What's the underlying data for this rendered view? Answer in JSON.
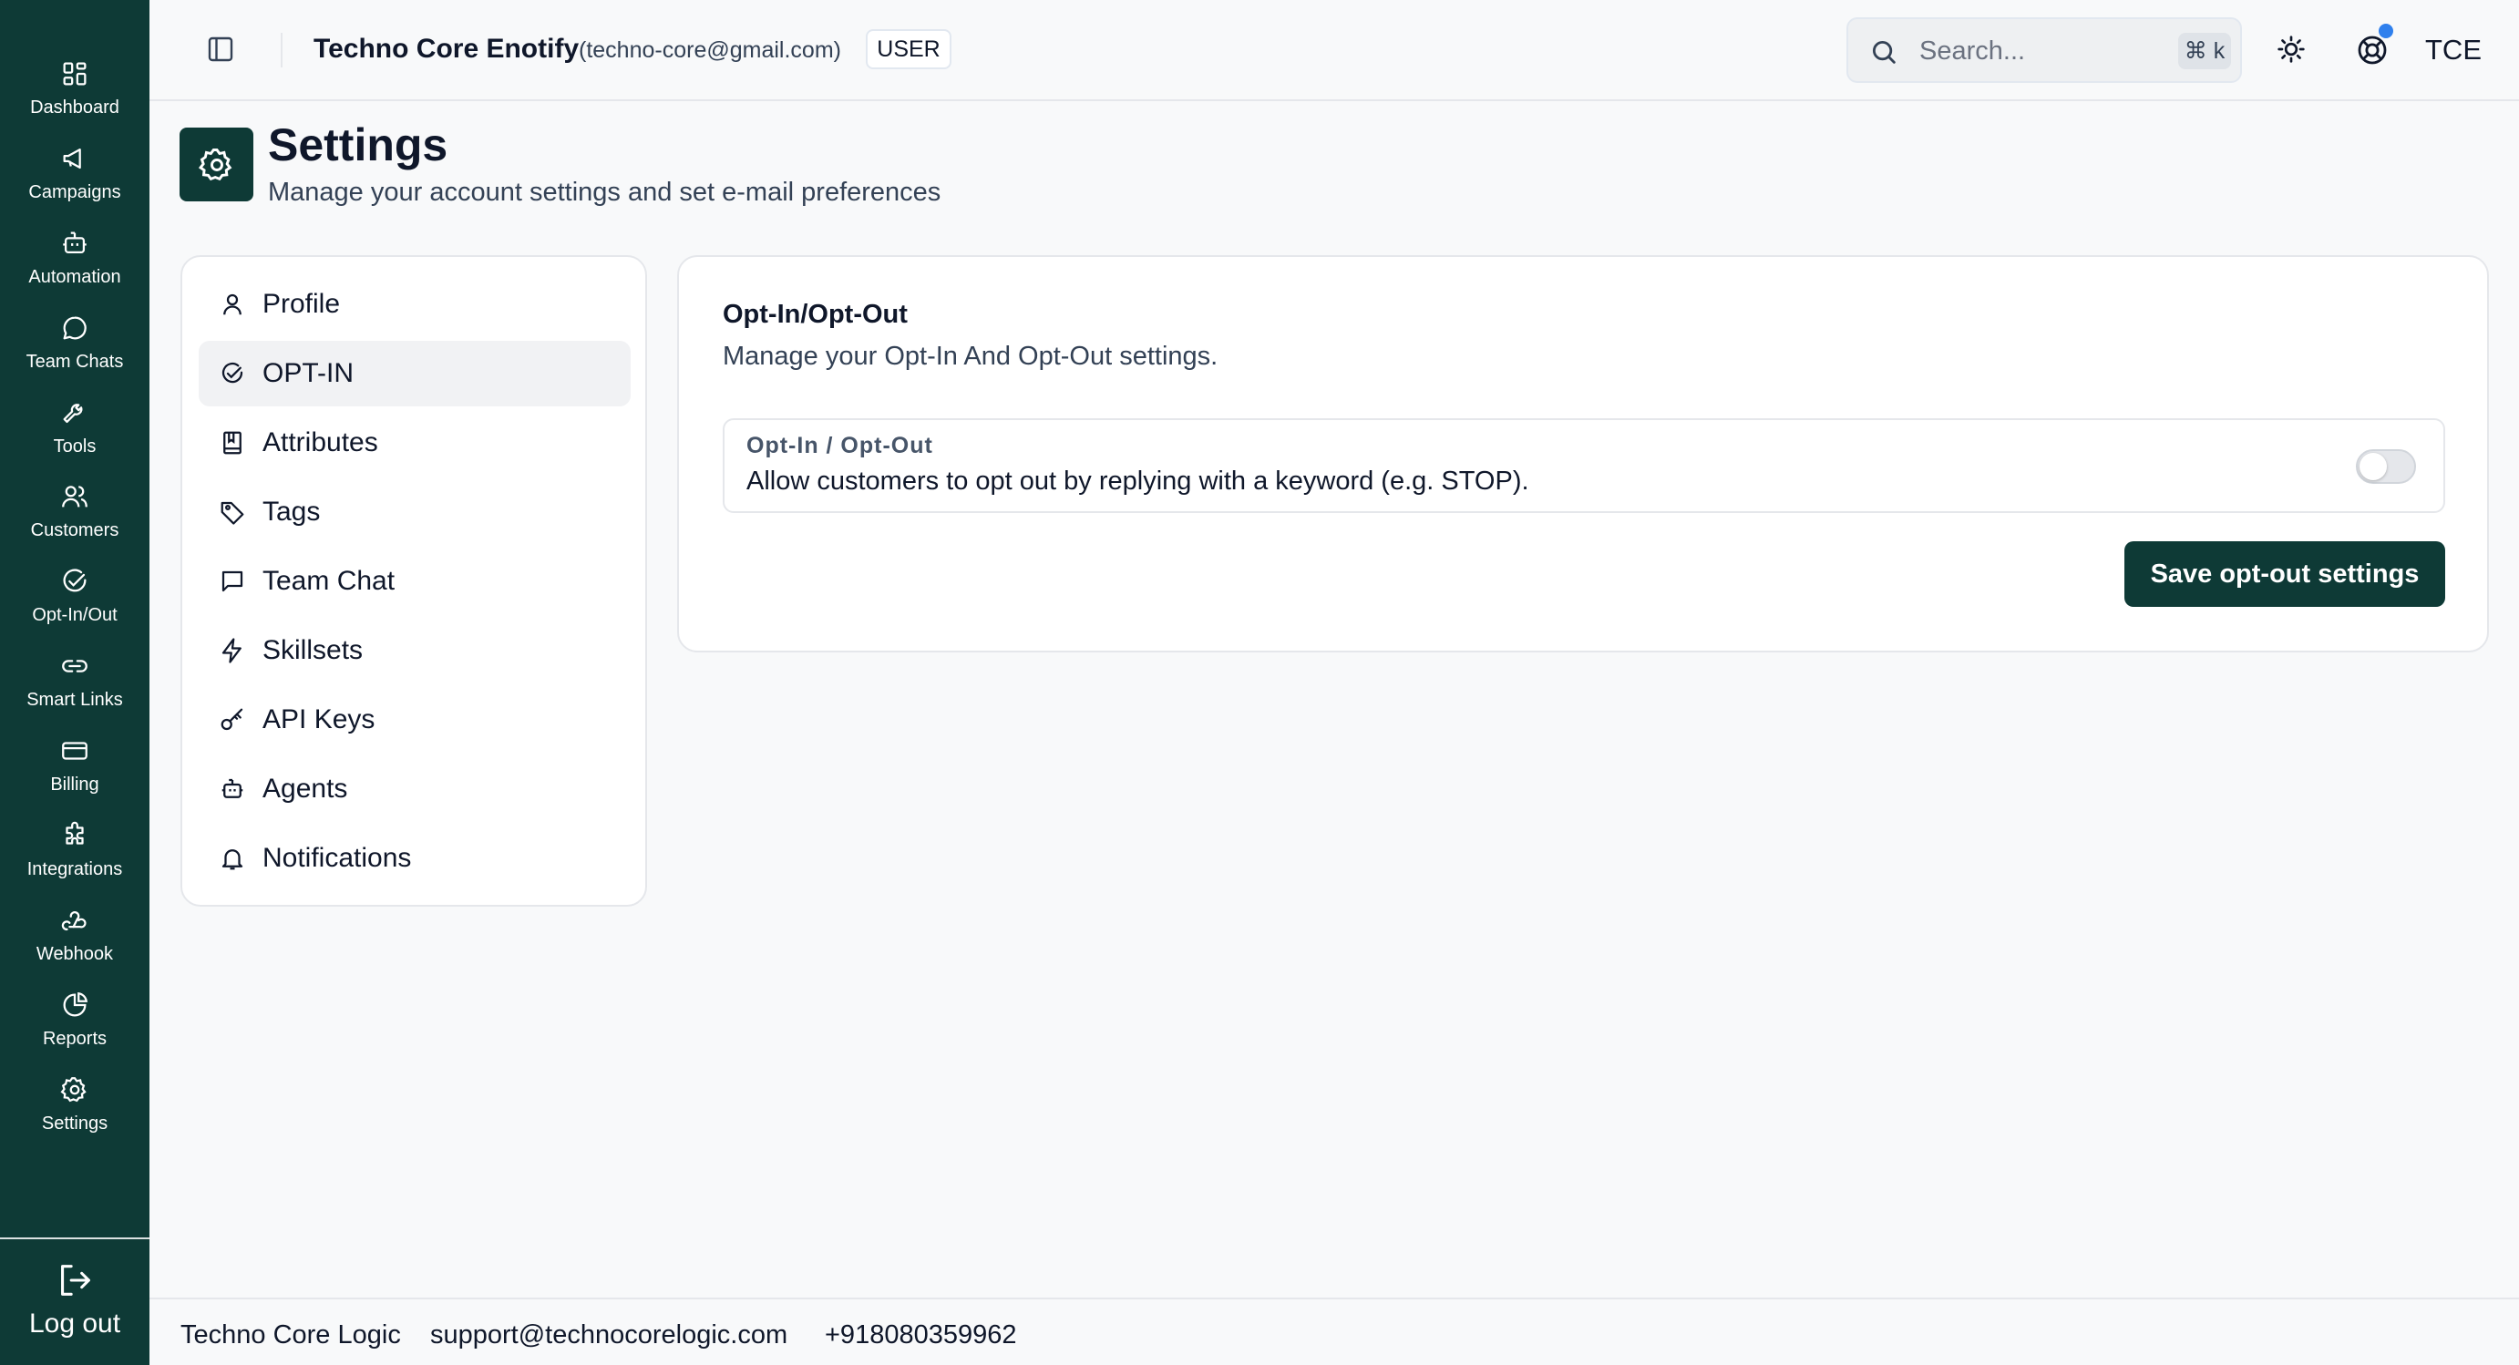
{
  "sidebar": {
    "items": [
      {
        "label": "Dashboard",
        "icon": "dashboard-icon"
      },
      {
        "label": "Campaigns",
        "icon": "megaphone-icon"
      },
      {
        "label": "Automation",
        "icon": "bot-icon"
      },
      {
        "label": "Team Chats",
        "icon": "chat-bubble-icon"
      },
      {
        "label": "Tools",
        "icon": "wrench-icon"
      },
      {
        "label": "Customers",
        "icon": "users-icon"
      },
      {
        "label": "Opt-In/Out",
        "icon": "check-circle-icon"
      },
      {
        "label": "Smart Links",
        "icon": "link-icon"
      },
      {
        "label": "Billing",
        "icon": "credit-card-icon"
      },
      {
        "label": "Integrations",
        "icon": "puzzle-icon"
      },
      {
        "label": "Webhook",
        "icon": "webhook-icon"
      },
      {
        "label": "Reports",
        "icon": "pie-chart-icon"
      },
      {
        "label": "Settings",
        "icon": "gear-icon"
      }
    ],
    "logout_label": "Log out"
  },
  "header": {
    "org_name": "Techno Core Enotify",
    "org_email": "(techno-core@gmail.com)",
    "role_badge": "USER",
    "search_placeholder": "Search...",
    "search_shortcut": "⌘ k",
    "avatar_initials": "TCE"
  },
  "page": {
    "title": "Settings",
    "subtitle": "Manage your account settings and set e-mail preferences"
  },
  "settings_nav": {
    "items": [
      {
        "label": "Profile",
        "icon": "user-icon",
        "active": false
      },
      {
        "label": "OPT-IN",
        "icon": "check-circle-icon",
        "active": true
      },
      {
        "label": "Attributes",
        "icon": "book-icon",
        "active": false
      },
      {
        "label": "Tags",
        "icon": "tag-icon",
        "active": false
      },
      {
        "label": "Team Chat",
        "icon": "message-square-icon",
        "active": false
      },
      {
        "label": "Skillsets",
        "icon": "zap-icon",
        "active": false
      },
      {
        "label": "API Keys",
        "icon": "key-icon",
        "active": false
      },
      {
        "label": "Agents",
        "icon": "bot-icon",
        "active": false
      },
      {
        "label": "Notifications",
        "icon": "bell-icon",
        "active": false
      }
    ]
  },
  "content": {
    "section_title": "Opt-In/Opt-Out",
    "section_subtitle": "Manage your Opt-In And Opt-Out settings.",
    "opt_label": "Opt-In / Opt-Out",
    "opt_description": "Allow customers to opt out by replying with a keyword (e.g. STOP).",
    "opt_enabled": false,
    "save_label": "Save opt-out settings"
  },
  "footer": {
    "company": "Techno Core Logic",
    "email": "support@technocorelogic.com",
    "phone": "+918080359962"
  },
  "colors": {
    "brand": "#0e3a36",
    "background": "#f8f9fa",
    "notification_dot": "#2f80ed"
  }
}
